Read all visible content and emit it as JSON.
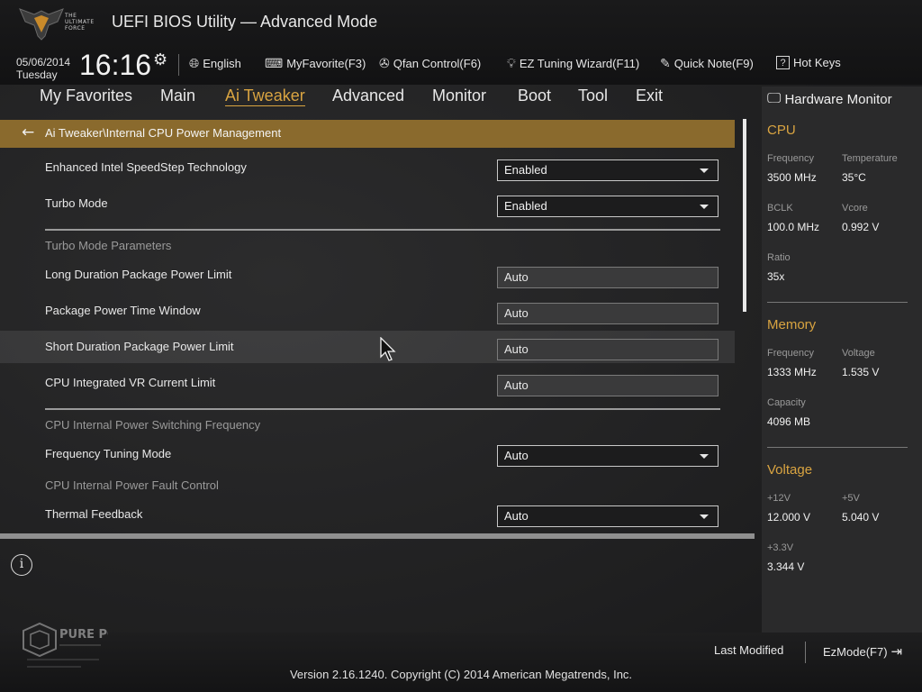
{
  "header": {
    "app_title": "UEFI BIOS Utility — Advanced Mode",
    "logo_text": "THE ULTIMATE FORCE",
    "date": "05/06/2014",
    "day": "Tuesday",
    "time": "16:16",
    "tools": {
      "language": "English",
      "myfavorite": "MyFavorite(F3)",
      "qfan": "Qfan Control(F6)",
      "ez_tuning": "EZ Tuning Wizard(F11)",
      "quick_note": "Quick Note(F9)",
      "hot_keys": "Hot Keys"
    }
  },
  "nav": {
    "my_favorites": "My Favorites",
    "main": "Main",
    "ai_tweaker": "Ai Tweaker",
    "advanced": "Advanced",
    "monitor": "Monitor",
    "boot": "Boot",
    "tool": "Tool",
    "exit": "Exit"
  },
  "breadcrumb": "Ai Tweaker\\Internal CPU Power Management",
  "settings": {
    "speedstep": {
      "label": "Enhanced Intel SpeedStep Technology",
      "value": "Enabled"
    },
    "turbo_mode": {
      "label": "Turbo Mode",
      "value": "Enabled"
    },
    "group_turbo": "Turbo Mode Parameters",
    "long_duration": {
      "label": "Long Duration Package Power Limit",
      "value": "Auto"
    },
    "time_window": {
      "label": "Package Power Time Window",
      "value": "Auto"
    },
    "short_duration": {
      "label": "Short Duration Package Power Limit",
      "value": "Auto"
    },
    "vr_current": {
      "label": "CPU Integrated VR Current Limit",
      "value": "Auto"
    },
    "group_switching": "CPU Internal Power Switching Frequency",
    "freq_tuning": {
      "label": "Frequency Tuning Mode",
      "value": "Auto"
    },
    "group_fault": "CPU Internal Power Fault Control",
    "thermal_feedback": {
      "label": "Thermal Feedback",
      "value": "Auto"
    }
  },
  "hardware_monitor": {
    "title": "Hardware Monitor",
    "cpu": {
      "heading": "CPU",
      "frequency_label": "Frequency",
      "frequency": "3500 MHz",
      "temperature_label": "Temperature",
      "temperature": "35°C",
      "bclk_label": "BCLK",
      "bclk": "100.0 MHz",
      "vcore_label": "Vcore",
      "vcore": "0.992 V",
      "ratio_label": "Ratio",
      "ratio": "35x"
    },
    "memory": {
      "heading": "Memory",
      "frequency_label": "Frequency",
      "frequency": "1333 MHz",
      "voltage_label": "Voltage",
      "voltage": "1.535 V",
      "capacity_label": "Capacity",
      "capacity": "4096 MB"
    },
    "voltage": {
      "heading": "Voltage",
      "v12_label": "+12V",
      "v12": "12.000 V",
      "v5_label": "+5V",
      "v5": "5.040 V",
      "v33_label": "+3.3V",
      "v33": "3.344 V"
    }
  },
  "footer": {
    "last_modified": "Last Modified",
    "ezmode": "EzMode(F7)",
    "version": "Version 2.16.1240. Copyright (C) 2014 American Megatrends, Inc."
  },
  "watermark": {
    "brand": "PURE PC"
  },
  "colors": {
    "accent": "#d9a441",
    "breadcrumb_bg": "#8a6a2d",
    "panel_bg": "#2a2a2b"
  }
}
